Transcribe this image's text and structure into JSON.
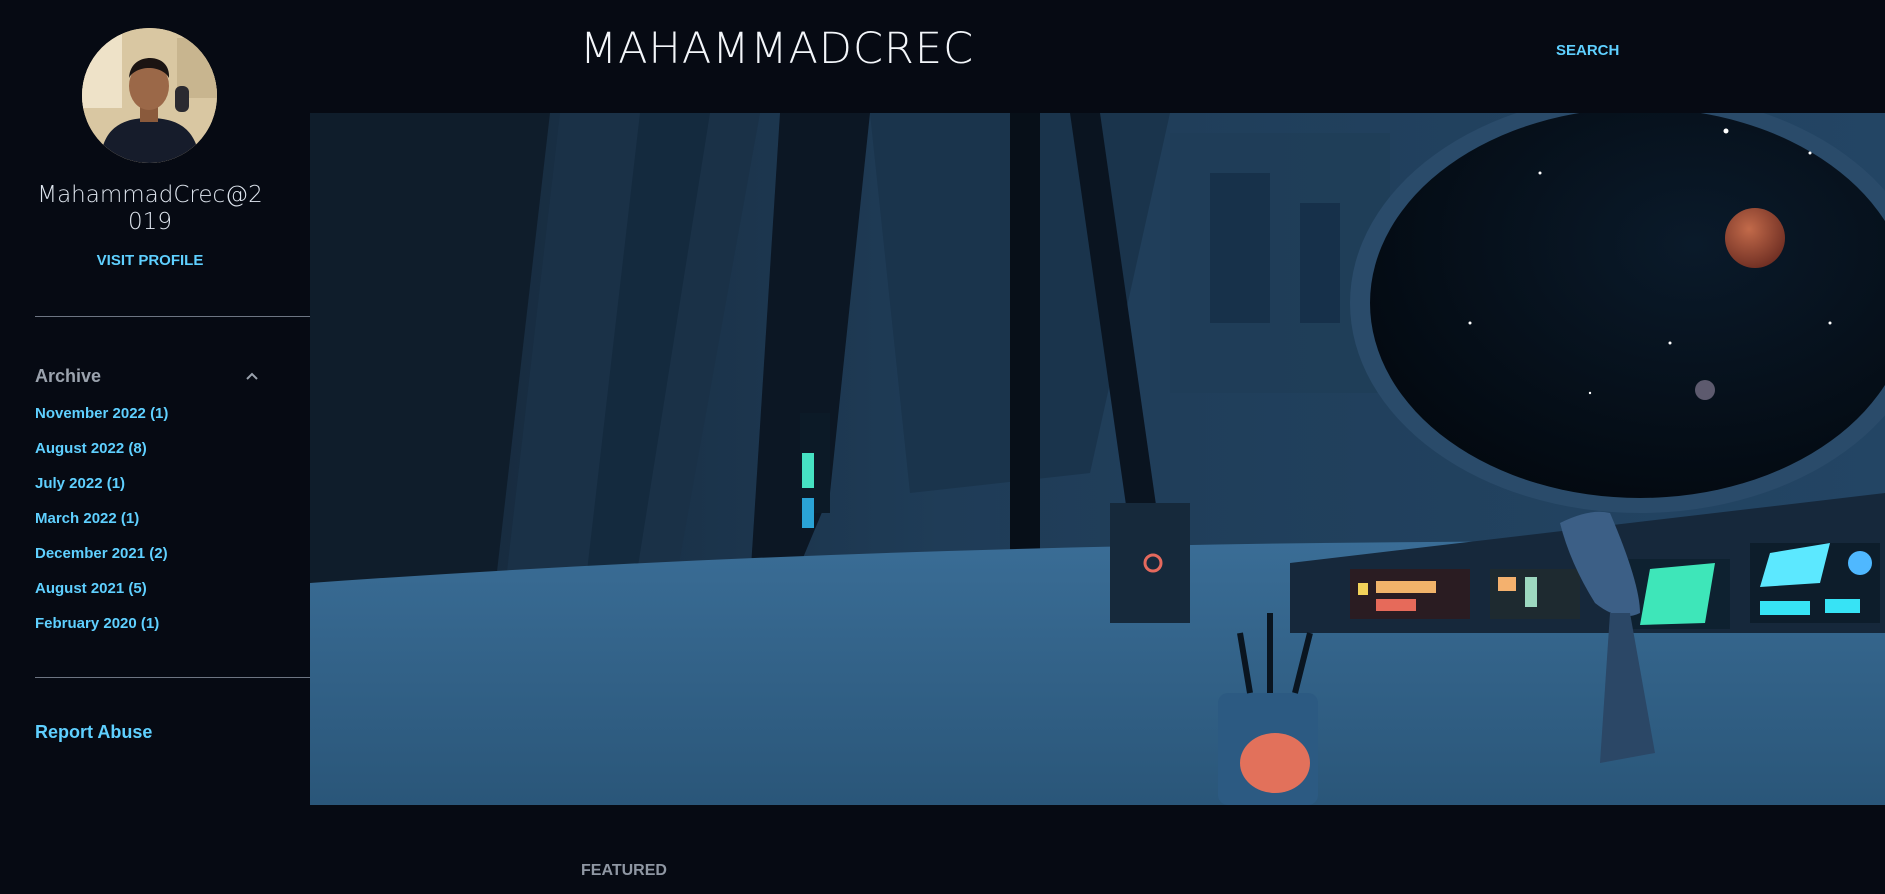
{
  "sidebar": {
    "profile_name": "MahammadCrec@2019",
    "visit_profile_label": "VISIT PROFILE",
    "archive": {
      "title": "Archive",
      "items": [
        {
          "label": "November 2022 (1)"
        },
        {
          "label": "August 2022 (8)"
        },
        {
          "label": "July 2022 (1)"
        },
        {
          "label": "March 2022 (1)"
        },
        {
          "label": "December 2021 (2)"
        },
        {
          "label": "August 2021 (5)"
        },
        {
          "label": "February 2020 (1)"
        }
      ]
    },
    "report_abuse_label": "Report Abuse"
  },
  "header": {
    "site_title": "MAHAMMADCREC",
    "search_label": "SEARCH"
  },
  "main": {
    "section_label": "FEATURED"
  },
  "icons": {
    "archive_toggle": "chevron-up-icon"
  },
  "colors": {
    "background": "#060a13",
    "accent": "#5fd0ff",
    "title": "#f3f6fa",
    "muted": "#8f97a3"
  }
}
